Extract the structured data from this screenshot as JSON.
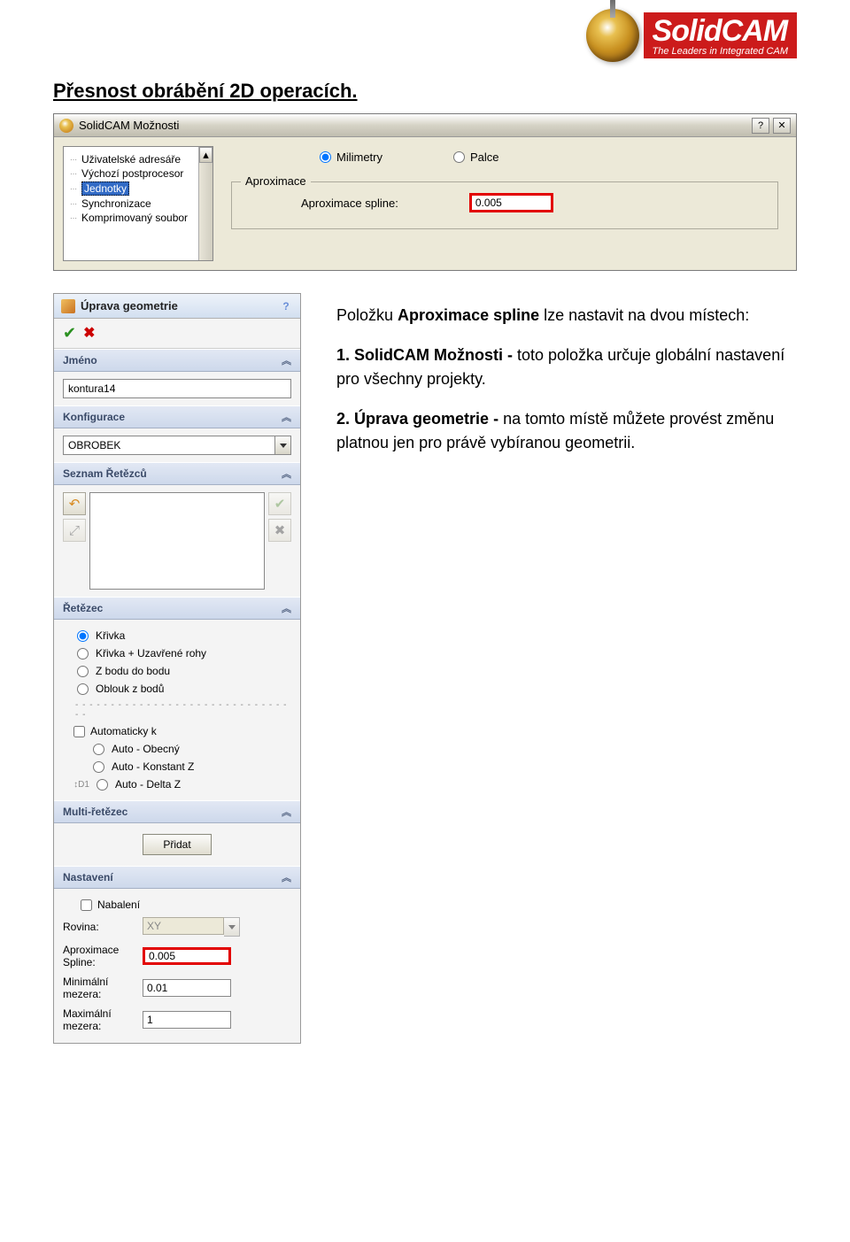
{
  "logo": {
    "title": "SolidCAM",
    "sub": "The Leaders in Integrated CAM"
  },
  "doc_heading": "Přesnost obrábění 2D operacích.",
  "moznosti": {
    "title": "SolidCAM Možnosti",
    "tree": [
      "Uživatelské adresáře",
      "Výchozí postprocesor",
      "Jednotky",
      "Synchronizace",
      "Komprimovaný soubor"
    ],
    "radio_mm": "Milimetry",
    "radio_in": "Palce",
    "fieldset": "Aproximace",
    "label": "Aproximace spline:",
    "value": "0.005"
  },
  "geo": {
    "title": "Úprava geometrie",
    "section_jmeno": "Jméno",
    "jmeno_value": "kontura14",
    "section_konfig": "Konfigurace",
    "konfig_value": "OBROBEK",
    "section_seznam": "Seznam Řetězců",
    "section_retezec": "Řetězec",
    "r_krivka": "Křivka",
    "r_krivka_rohy": "Křivka + Uzavřené rohy",
    "r_zbodu": "Z bodu do bodu",
    "r_oblouk": "Oblouk z bodů",
    "chk_auto": "Automaticky k",
    "r_auto_obec": "Auto - Obecný",
    "r_auto_kz": "Auto - Konstant Z",
    "r_auto_dz": "Auto - Delta Z",
    "section_multi": "Multi-řetězec",
    "btn_pridat": "Přidat",
    "section_nast": "Nastavení",
    "chk_nabaleni": "Nabalení",
    "lbl_rovina": "Rovina:",
    "val_rovina": "XY",
    "lbl_aprox": "Aproximace Spline:",
    "val_aprox": "0.005",
    "lbl_min": "Minimální mezera:",
    "val_min": "0.01",
    "lbl_max": "Maximální mezera:",
    "val_max": "1"
  },
  "article": {
    "p1a": "Položku ",
    "p1b": "Aproximace spline",
    "p1c": " lze nastavit na dvou místech:",
    "p2a": "1. SolidCAM Možnosti - ",
    "p2b": "toto položka určuje globální nastavení pro všechny projekty.",
    "p3a": "2. Úprava geometrie - ",
    "p3b": "na tomto místě můžete provést změnu platnou jen pro právě vybíranou geometrii."
  }
}
